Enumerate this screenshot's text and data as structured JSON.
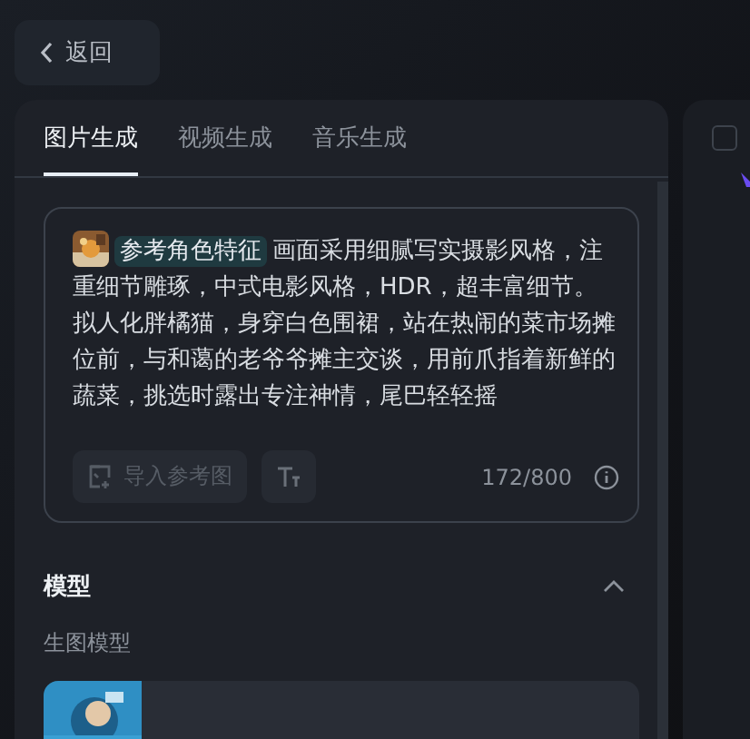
{
  "back_button": {
    "label": "返回"
  },
  "tabs": [
    {
      "label": "图片生成",
      "selected": true
    },
    {
      "label": "视频生成",
      "selected": false
    },
    {
      "label": "音乐生成",
      "selected": false
    }
  ],
  "prompt": {
    "tag": "参考角色特征",
    "text": "画面采用细腻写实摄影风格，注重细节雕琢，中式电影风格，HDR，超丰富细节。拟人化胖橘猫，身穿白色围裙，站在热闹的菜市场摊位前，与和蔼的老爷爷摊主交谈，用前爪指着新鲜的蔬菜，挑选时露出专注神情，尾巴轻轻摇",
    "import_button": {
      "label": "导入参考图",
      "disabled": true
    },
    "counter": "172/800"
  },
  "model_section": {
    "title": "模型",
    "expanded": true,
    "subtitle": "生图模型"
  },
  "side_panel": {
    "checkbox_checked": false
  }
}
